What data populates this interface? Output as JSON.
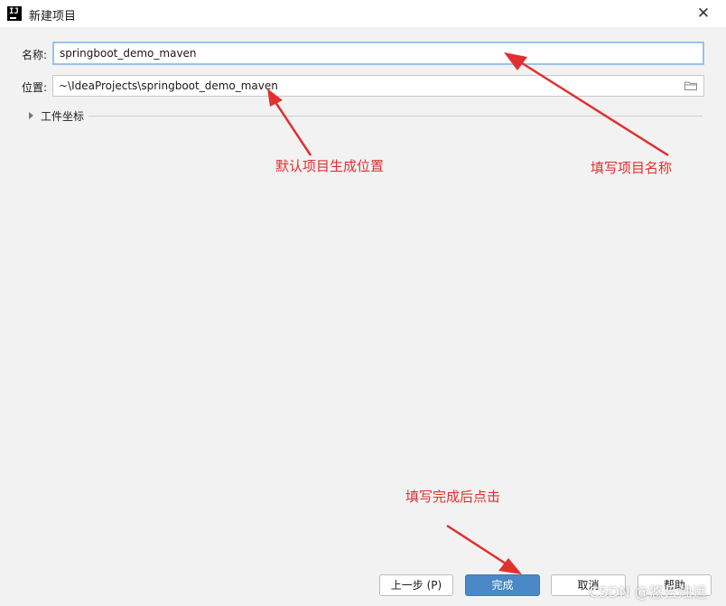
{
  "window": {
    "title": "新建项目",
    "close_glyph": "✕",
    "app_icon_text": "IJ"
  },
  "form": {
    "name_label": "名称:",
    "name_value": "springboot_demo_maven",
    "location_label": "位置:",
    "location_value": "~\\IdeaProjects\\springboot_demo_maven",
    "folder_icon": "folder-icon"
  },
  "section": {
    "label": "工件坐标",
    "expanded": false
  },
  "annotations": {
    "fill_name": "填写项目名称",
    "default_location": "默认项目生成位置",
    "click_after_done": "填写完成后点击",
    "color": "#e0302f"
  },
  "buttons": {
    "prev": "上一步 (P)",
    "finish": "完成",
    "cancel": "取消",
    "help": "帮助"
  },
  "watermark": "CSDN @悠云烛远",
  "colors": {
    "accent": "#4a88c7",
    "focus_border": "#97c3ec"
  }
}
